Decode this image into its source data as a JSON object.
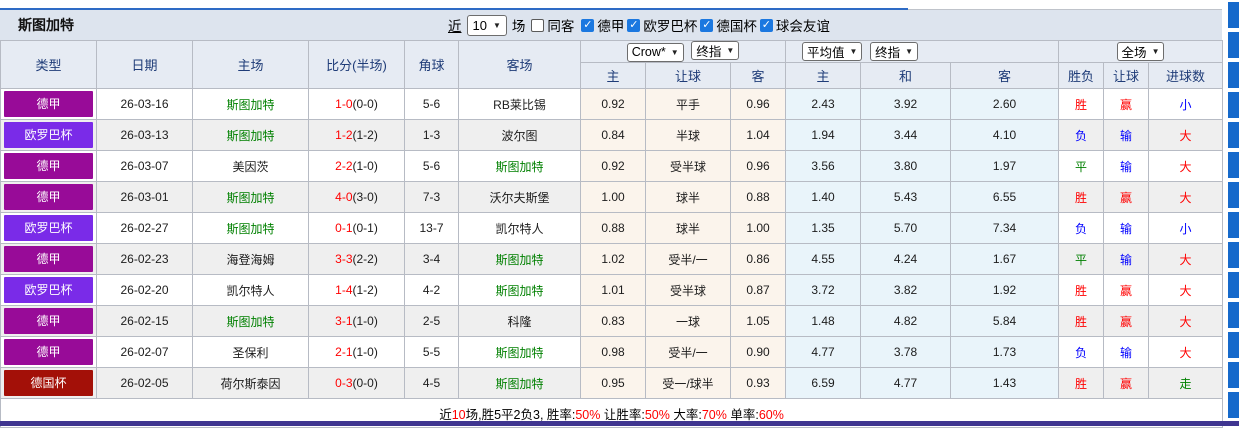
{
  "toolbar": {
    "title": "斯图加特",
    "recent_label": "近",
    "recent_value": "10",
    "games_label": "场",
    "same_away_label": "同客",
    "leagues": [
      {
        "label": "德甲",
        "checked": true
      },
      {
        "label": "欧罗巴杯",
        "checked": true
      },
      {
        "label": "德国杯",
        "checked": true
      },
      {
        "label": "球会友谊",
        "checked": true
      }
    ]
  },
  "header": {
    "type": "类型",
    "date": "日期",
    "home": "主场",
    "score": "比分(半场)",
    "corners": "角球",
    "away": "客场",
    "g1_select1": "Crow*",
    "g1_select2": "终指",
    "g2_select1": "平均值",
    "g2_select2": "终指",
    "g3_select1": "全场",
    "g1_home": "主",
    "g1_handicap": "让球",
    "g1_away": "客",
    "g2_home": "主",
    "g2_draw": "和",
    "g2_away": "客",
    "g3_result": "胜负",
    "g3_handicap": "让球",
    "g3_goals": "进球数"
  },
  "rows": [
    {
      "league": "德甲",
      "league_color": "#980B98",
      "date": "26-03-16",
      "home": "斯图加特",
      "home_highlight": true,
      "score": "1-0",
      "half": "(0-0)",
      "corners": "5-6",
      "away": "RB莱比锡",
      "away_highlight": false,
      "odds_home": "0.92",
      "handicap": "平手",
      "odds_away": "0.96",
      "avg_home": "2.43",
      "avg_draw": "3.92",
      "avg_away": "2.60",
      "result": "胜",
      "result_color": "#ff0000",
      "handicap_result": "赢",
      "handicap_result_color": "#ff0000",
      "goals": "小",
      "goals_color": "#0000ff"
    },
    {
      "league": "欧罗巴杯",
      "league_color": "#7A2BE8",
      "date": "26-03-13",
      "home": "斯图加特",
      "home_highlight": true,
      "score": "1-2",
      "half": "(1-2)",
      "corners": "1-3",
      "away": "波尔图",
      "away_highlight": false,
      "odds_home": "0.84",
      "handicap": "半球",
      "odds_away": "1.04",
      "avg_home": "1.94",
      "avg_draw": "3.44",
      "avg_away": "4.10",
      "result": "负",
      "result_color": "#0000ff",
      "handicap_result": "输",
      "handicap_result_color": "#0000ff",
      "goals": "大",
      "goals_color": "#ff0000"
    },
    {
      "league": "德甲",
      "league_color": "#980B98",
      "date": "26-03-07",
      "home": "美因茨",
      "home_highlight": false,
      "score": "2-2",
      "half": "(1-0)",
      "corners": "5-6",
      "away": "斯图加特",
      "away_highlight": true,
      "odds_home": "0.92",
      "handicap": "受半球",
      "odds_away": "0.96",
      "avg_home": "3.56",
      "avg_draw": "3.80",
      "avg_away": "1.97",
      "result": "平",
      "result_color": "#008000",
      "handicap_result": "输",
      "handicap_result_color": "#0000ff",
      "goals": "大",
      "goals_color": "#ff0000"
    },
    {
      "league": "德甲",
      "league_color": "#980B98",
      "date": "26-03-01",
      "home": "斯图加特",
      "home_highlight": true,
      "score": "4-0",
      "half": "(3-0)",
      "corners": "7-3",
      "away": "沃尔夫斯堡",
      "away_highlight": false,
      "odds_home": "1.00",
      "handicap": "球半",
      "odds_away": "0.88",
      "avg_home": "1.40",
      "avg_draw": "5.43",
      "avg_away": "6.55",
      "result": "胜",
      "result_color": "#ff0000",
      "handicap_result": "赢",
      "handicap_result_color": "#ff0000",
      "goals": "大",
      "goals_color": "#ff0000"
    },
    {
      "league": "欧罗巴杯",
      "league_color": "#7A2BE8",
      "date": "26-02-27",
      "home": "斯图加特",
      "home_highlight": true,
      "score": "0-1",
      "half": "(0-1)",
      "corners": "13-7",
      "away": "凯尔特人",
      "away_highlight": false,
      "odds_home": "0.88",
      "handicap": "球半",
      "odds_away": "1.00",
      "avg_home": "1.35",
      "avg_draw": "5.70",
      "avg_away": "7.34",
      "result": "负",
      "result_color": "#0000ff",
      "handicap_result": "输",
      "handicap_result_color": "#0000ff",
      "goals": "小",
      "goals_color": "#0000ff"
    },
    {
      "league": "德甲",
      "league_color": "#980B98",
      "date": "26-02-23",
      "home": "海登海姆",
      "home_highlight": false,
      "score": "3-3",
      "half": "(2-2)",
      "corners": "3-4",
      "away": "斯图加特",
      "away_highlight": true,
      "odds_home": "1.02",
      "handicap": "受半/一",
      "odds_away": "0.86",
      "avg_home": "4.55",
      "avg_draw": "4.24",
      "avg_away": "1.67",
      "result": "平",
      "result_color": "#008000",
      "handicap_result": "输",
      "handicap_result_color": "#0000ff",
      "goals": "大",
      "goals_color": "#ff0000"
    },
    {
      "league": "欧罗巴杯",
      "league_color": "#7A2BE8",
      "date": "26-02-20",
      "home": "凯尔特人",
      "home_highlight": false,
      "score": "1-4",
      "half": "(1-2)",
      "corners": "4-2",
      "away": "斯图加特",
      "away_highlight": true,
      "odds_home": "1.01",
      "handicap": "受半球",
      "odds_away": "0.87",
      "avg_home": "3.72",
      "avg_draw": "3.82",
      "avg_away": "1.92",
      "result": "胜",
      "result_color": "#ff0000",
      "handicap_result": "赢",
      "handicap_result_color": "#ff0000",
      "goals": "大",
      "goals_color": "#ff0000"
    },
    {
      "league": "德甲",
      "league_color": "#980B98",
      "date": "26-02-15",
      "home": "斯图加特",
      "home_highlight": true,
      "score": "3-1",
      "half": "(1-0)",
      "corners": "2-5",
      "away": "科隆",
      "away_highlight": false,
      "odds_home": "0.83",
      "handicap": "一球",
      "odds_away": "1.05",
      "avg_home": "1.48",
      "avg_draw": "4.82",
      "avg_away": "5.84",
      "result": "胜",
      "result_color": "#ff0000",
      "handicap_result": "赢",
      "handicap_result_color": "#ff0000",
      "goals": "大",
      "goals_color": "#ff0000"
    },
    {
      "league": "德甲",
      "league_color": "#980B98",
      "date": "26-02-07",
      "home": "圣保利",
      "home_highlight": false,
      "score": "2-1",
      "half": "(1-0)",
      "corners": "5-5",
      "away": "斯图加特",
      "away_highlight": true,
      "odds_home": "0.98",
      "handicap": "受半/一",
      "odds_away": "0.90",
      "avg_home": "4.77",
      "avg_draw": "3.78",
      "avg_away": "1.73",
      "result": "负",
      "result_color": "#0000ff",
      "handicap_result": "输",
      "handicap_result_color": "#0000ff",
      "goals": "大",
      "goals_color": "#ff0000"
    },
    {
      "league": "德国杯",
      "league_color": "#A31008",
      "date": "26-02-05",
      "home": "荷尔斯泰因",
      "home_highlight": false,
      "score": "0-3",
      "half": "(0-0)",
      "corners": "4-5",
      "away": "斯图加特",
      "away_highlight": true,
      "odds_home": "0.95",
      "handicap": "受一/球半",
      "odds_away": "0.93",
      "avg_home": "6.59",
      "avg_draw": "4.77",
      "avg_away": "1.43",
      "result": "胜",
      "result_color": "#ff0000",
      "handicap_result": "赢",
      "handicap_result_color": "#ff0000",
      "goals": "走",
      "goals_color": "#008000"
    }
  ],
  "summary": {
    "segments": [
      {
        "text": "近",
        "red": false
      },
      {
        "text": "10",
        "red": true
      },
      {
        "text": "场,胜5平2负3, 胜率:",
        "red": false
      },
      {
        "text": "50%",
        "red": true
      },
      {
        "text": " 让胜率:",
        "red": false
      },
      {
        "text": "50%",
        "red": true
      },
      {
        "text": " 大率:",
        "red": false
      },
      {
        "text": "70%",
        "red": true
      },
      {
        "text": " 单率:",
        "red": false
      },
      {
        "text": "60%",
        "red": true
      }
    ]
  },
  "colors": {
    "win": "#ff0000",
    "draw": "#008000",
    "lose": "#0000ff",
    "team_highlight": "#008000",
    "score_red": "#ff0000",
    "league_bundesliga": "#980B98",
    "league_europa": "#7A2BE8",
    "league_dfb_pokal": "#A31008",
    "accent_blue_strip": "#1569cb",
    "bottom_divider": "#3f3590"
  }
}
